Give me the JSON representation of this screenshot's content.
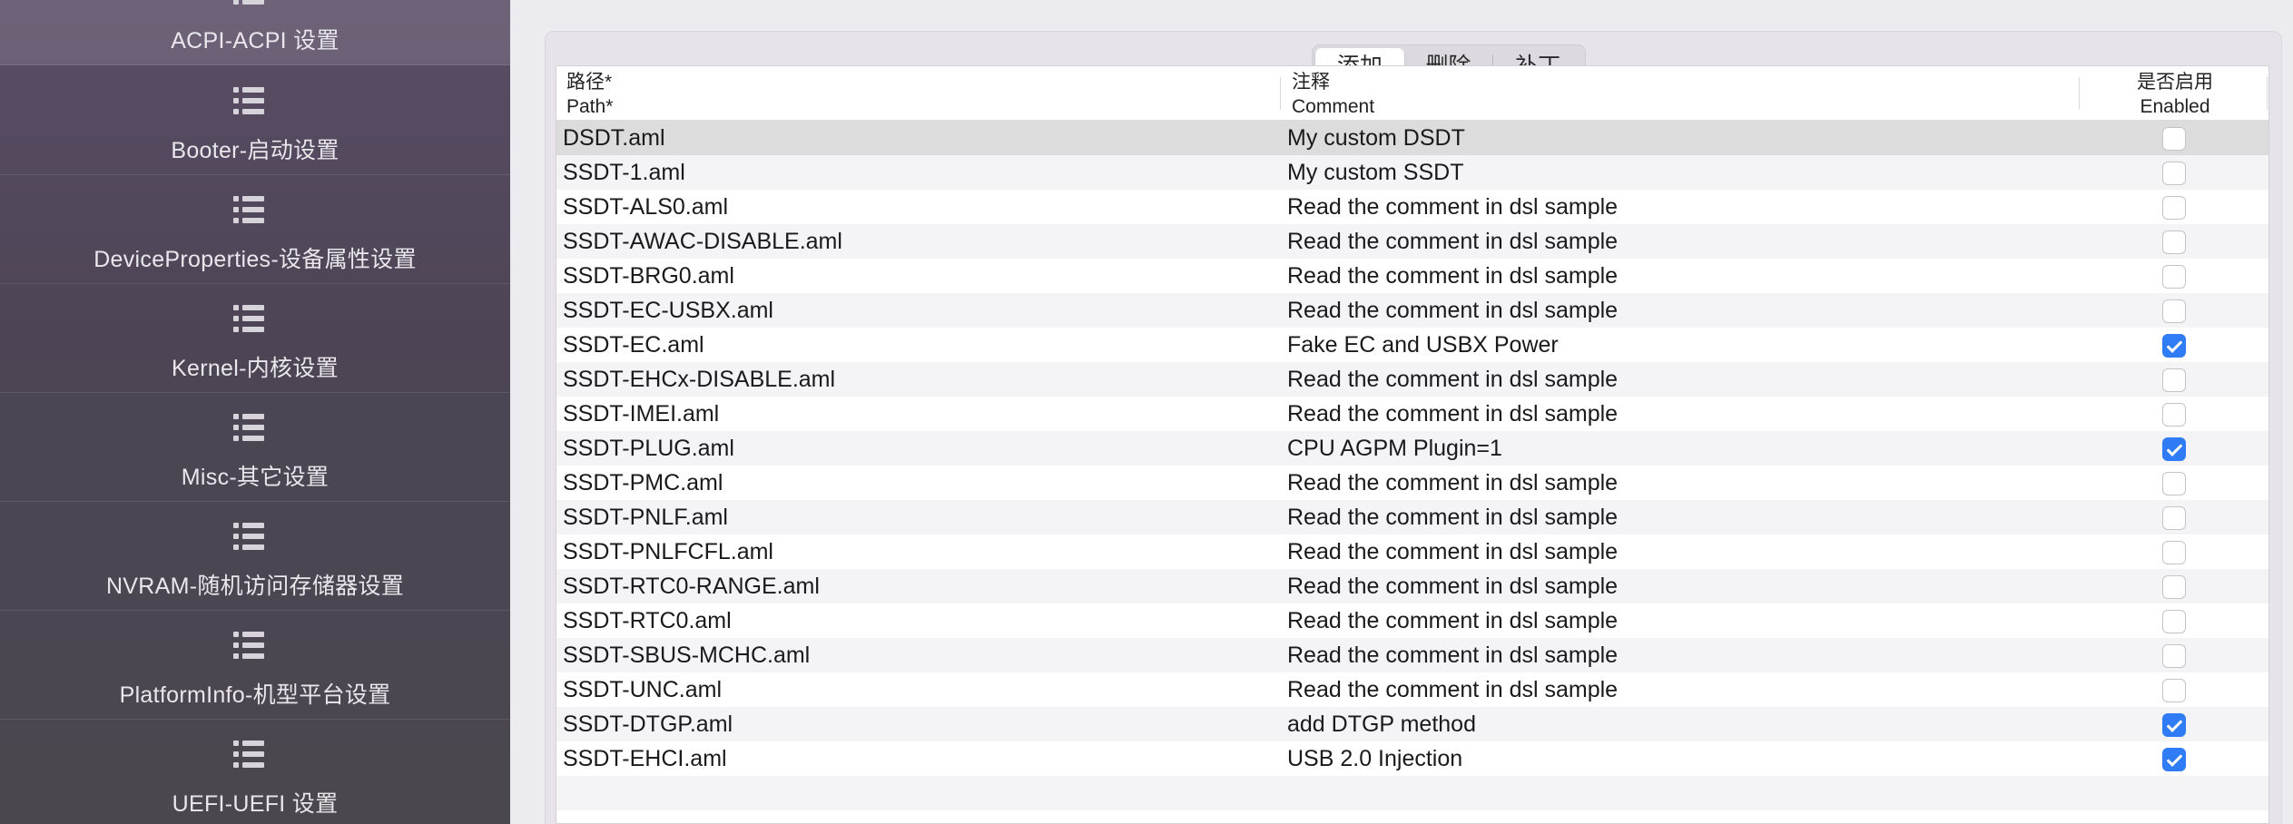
{
  "sidebar": {
    "items": [
      {
        "label": "ACPI-ACPI 设置",
        "selected": true
      },
      {
        "label": "Booter-启动设置"
      },
      {
        "label": "DeviceProperties-设备属性设置"
      },
      {
        "label": "Kernel-内核设置"
      },
      {
        "label": "Misc-其它设置"
      },
      {
        "label": "NVRAM-随机访问存储器设置"
      },
      {
        "label": "PlatformInfo-机型平台设置"
      },
      {
        "label": "UEFI-UEFI 设置"
      }
    ],
    "icon": "list-icon"
  },
  "segmented": {
    "add": "添加",
    "delete": "删除",
    "patch": "补丁",
    "selected": "添加"
  },
  "table": {
    "headers": {
      "path_cn": "路径*",
      "path_en": "Path*",
      "comment_cn": "注释",
      "comment_en": "Comment",
      "enabled_cn": "是否启用",
      "enabled_en": "Enabled"
    },
    "rows": [
      {
        "path": "DSDT.aml",
        "comment": "My custom DSDT",
        "enabled": false
      },
      {
        "path": "SSDT-1.aml",
        "comment": "My custom SSDT",
        "enabled": false
      },
      {
        "path": "SSDT-ALS0.aml",
        "comment": "Read the comment in dsl sample",
        "enabled": false
      },
      {
        "path": "SSDT-AWAC-DISABLE.aml",
        "comment": "Read the comment in dsl sample",
        "enabled": false
      },
      {
        "path": "SSDT-BRG0.aml",
        "comment": "Read the comment in dsl sample",
        "enabled": false
      },
      {
        "path": "SSDT-EC-USBX.aml",
        "comment": "Read the comment in dsl sample",
        "enabled": false
      },
      {
        "path": "SSDT-EC.aml",
        "comment": "Fake EC and USBX Power",
        "enabled": true
      },
      {
        "path": "SSDT-EHCx-DISABLE.aml",
        "comment": "Read the comment in dsl sample",
        "enabled": false
      },
      {
        "path": "SSDT-IMEI.aml",
        "comment": "Read the comment in dsl sample",
        "enabled": false
      },
      {
        "path": "SSDT-PLUG.aml",
        "comment": "CPU AGPM Plugin=1",
        "enabled": true
      },
      {
        "path": "SSDT-PMC.aml",
        "comment": "Read the comment in dsl sample",
        "enabled": false
      },
      {
        "path": "SSDT-PNLF.aml",
        "comment": "Read the comment in dsl sample",
        "enabled": false
      },
      {
        "path": "SSDT-PNLFCFL.aml",
        "comment": "Read the comment in dsl sample",
        "enabled": false
      },
      {
        "path": "SSDT-RTC0-RANGE.aml",
        "comment": "Read the comment in dsl sample",
        "enabled": false
      },
      {
        "path": "SSDT-RTC0.aml",
        "comment": "Read the comment in dsl sample",
        "enabled": false
      },
      {
        "path": "SSDT-SBUS-MCHC.aml",
        "comment": "Read the comment in dsl sample",
        "enabled": false
      },
      {
        "path": "SSDT-UNC.aml",
        "comment": "Read the comment in dsl sample",
        "enabled": false
      },
      {
        "path": "SSDT-DTGP.aml",
        "comment": "add DTGP method",
        "enabled": true
      },
      {
        "path": "SSDT-EHCI.aml",
        "comment": "USB 2.0 Injection",
        "enabled": true
      }
    ]
  },
  "colors": {
    "accent": "#2f7cf6",
    "sidebar_bg": "#4d4555"
  }
}
